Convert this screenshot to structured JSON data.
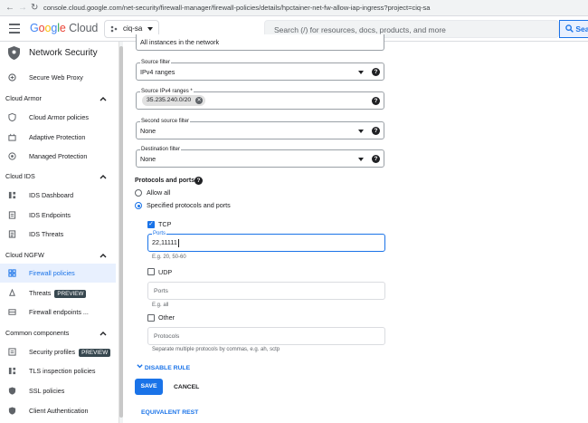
{
  "browser": {
    "url": "console.cloud.google.com/net-security/firewall-manager/firewall-policies/details/hpctainer-net-fw-allow-iap-ingress?project=ciq-sa"
  },
  "topbar": {
    "logo": {
      "google": "Google",
      "cloud": "Cloud"
    },
    "project": "ciq-sa",
    "search_placeholder": "Search (/) for resources, docs, products, and more",
    "search_button": "Sea"
  },
  "sidebar": {
    "product_title": "Network Security",
    "items_top": [
      {
        "label": "Secure Web Proxy",
        "icon": "proxy-icon"
      }
    ],
    "sections": [
      {
        "title": "Cloud Armor",
        "items": [
          {
            "label": "Cloud Armor policies",
            "icon": "shield-icon"
          },
          {
            "label": "Adaptive Protection",
            "icon": "adaptive-icon"
          },
          {
            "label": "Managed Protection",
            "icon": "managed-protection-icon"
          }
        ]
      },
      {
        "title": "Cloud IDS",
        "items": [
          {
            "label": "IDS Dashboard",
            "icon": "dashboard-icon"
          },
          {
            "label": "IDS Endpoints",
            "icon": "endpoints-icon"
          },
          {
            "label": "IDS Threats",
            "icon": "threats-icon"
          }
        ]
      },
      {
        "title": "Cloud NGFW",
        "items": [
          {
            "label": "Firewall policies",
            "icon": "firewall-policies-icon",
            "active": true
          },
          {
            "label": "Threats",
            "icon": "threats-icon",
            "badge": "PREVIEW"
          },
          {
            "label": "Firewall endpoints ...",
            "icon": "firewall-endpoints-icon"
          }
        ]
      },
      {
        "title": "Common components",
        "items": [
          {
            "label": "Security profiles",
            "icon": "security-profiles-icon",
            "badge": "PREVIEW"
          },
          {
            "label": "TLS inspection policies",
            "icon": "tls-icon"
          },
          {
            "label": "SSL policies",
            "icon": "ssl-icon"
          },
          {
            "label": "Client Authentication",
            "icon": "client-auth-icon"
          }
        ]
      }
    ]
  },
  "form": {
    "targets_value": "All instances in the network",
    "source_filter": {
      "label": "Source filter",
      "value": "IPv4 ranges"
    },
    "source_ranges": {
      "label": "Source IPv4 ranges *",
      "chip": "35.235.240.0/20"
    },
    "second_source_filter": {
      "label": "Second source filter",
      "value": "None"
    },
    "destination_filter": {
      "label": "Destination filter",
      "value": "None"
    },
    "protocols": {
      "title": "Protocols and ports",
      "allow_all": "Allow all",
      "specified": "Specified protocols and ports",
      "selected": "specified",
      "tcp": {
        "label": "TCP",
        "checked": true,
        "ports_label": "Ports",
        "ports_value": "22,11111",
        "hint": "E.g. 20, 50-60"
      },
      "udp": {
        "label": "UDP",
        "checked": false,
        "ports_placeholder": "Ports",
        "hint": "E.g. all"
      },
      "other": {
        "label": "Other",
        "checked": false,
        "placeholder": "Protocols",
        "hint": "Separate multiple protocols by commas, e.g. ah, sctp"
      }
    },
    "disable_rule": "DISABLE RULE",
    "save": "SAVE",
    "cancel": "CANCEL",
    "equivalent_rest": "EQUIVALENT REST"
  },
  "colors": {
    "accent": "#1a73e8",
    "active_bg": "#e8f0fe",
    "badge_bg": "#37474f"
  }
}
